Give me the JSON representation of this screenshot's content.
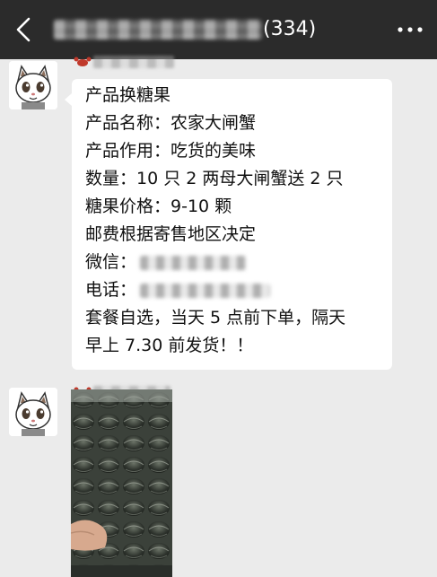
{
  "header": {
    "member_count": "(334)"
  },
  "message_1": {
    "lines": [
      "产品换糖果",
      "产品名称：农家大闸蟹",
      "产品作用：吃货的美味",
      "数量：10 只 2 两母大闸蟹送 2 只",
      "糖果价格：9-10 颗",
      "邮费根据寄售地区决定",
      "微信：",
      "电话：",
      "套餐自选，当天 5 点前下单，隔天",
      "早上 7.30 前发货！！"
    ]
  },
  "colors": {
    "header_bg": "#2b2b2b",
    "chat_bg": "#ebebeb",
    "bubble_bg": "#ffffff",
    "text": "#111111"
  },
  "icons": [
    "back-icon",
    "more-icon",
    "avatar-cat",
    "crab-icon"
  ]
}
